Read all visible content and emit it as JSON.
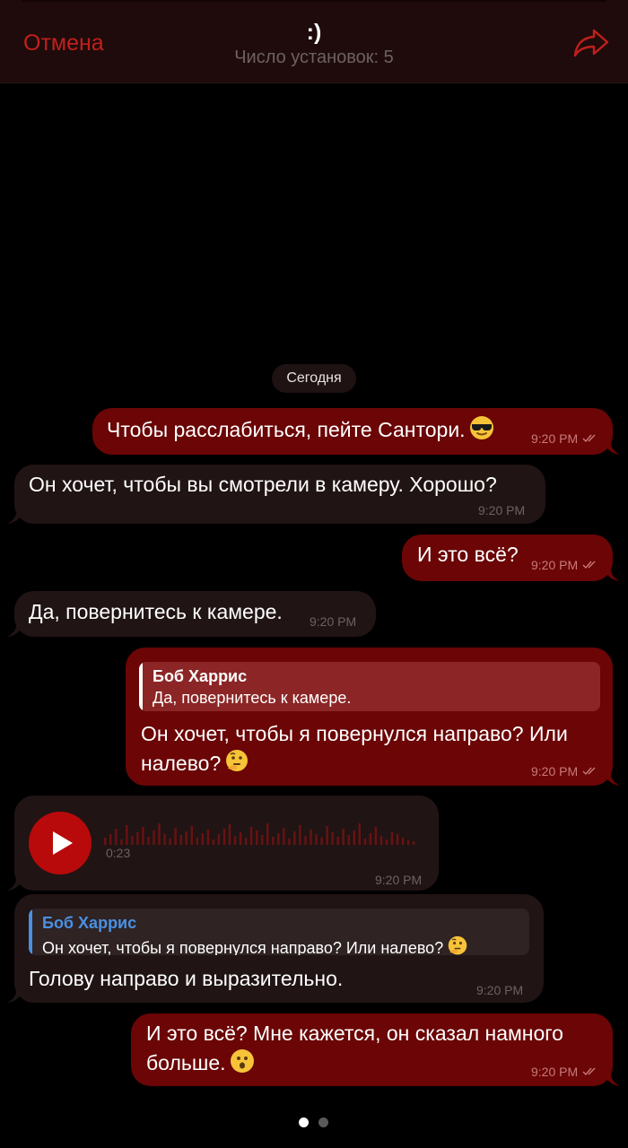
{
  "header": {
    "cancel_label": "Отмена",
    "title": ":)",
    "subtitle": "Число установок: 5",
    "share_icon": "share-arrow-icon"
  },
  "date_label": "Сегодня",
  "messages": [
    {
      "side": "out",
      "text": "Чтобы расслабиться, пейте Сантори.",
      "emoji": "smiling-face-with-sunglasses",
      "time": "9:20 PM",
      "read": true
    },
    {
      "side": "in",
      "text": "Он хочет, чтобы вы смотрели в камеру. Хорошо?",
      "time": "9:20 PM"
    },
    {
      "side": "out",
      "text": "И это всё?",
      "time": "9:20 PM",
      "read": true
    },
    {
      "side": "in",
      "text": "Да, повернитесь к камере.",
      "time": "9:20 PM"
    },
    {
      "side": "out",
      "reply": {
        "name": "Боб Харрис",
        "text": "Да, повернитесь к камере."
      },
      "lines": [
        "Он хочет, чтобы я повернулся направо? Или",
        "налево?"
      ],
      "emoji": "thinking-face",
      "time": "9:20 PM",
      "read": true
    },
    {
      "side": "in",
      "type": "voice",
      "duration": "0:23",
      "time": "9:20 PM"
    },
    {
      "side": "in",
      "reply": {
        "name": "Боб Харрис",
        "text": "Он хочет, чтобы я повернулся направо? Или налево?",
        "emoji": "thinking-face"
      },
      "text": "Голову направо и выразительно.",
      "time": "9:20 PM"
    },
    {
      "side": "out",
      "lines": [
        "И это всё? Мне кажется, он сказал намного",
        "больше."
      ],
      "emoji": "hushed-face",
      "time": "9:20 PM",
      "read": true
    }
  ],
  "pager": {
    "pages": 2,
    "current": 1
  },
  "colors": {
    "accent": "#c0201c",
    "outgoing_bubble": "#6b0506",
    "incoming_bubble": "#211414",
    "quote_name_incoming": "#4a90e2"
  }
}
